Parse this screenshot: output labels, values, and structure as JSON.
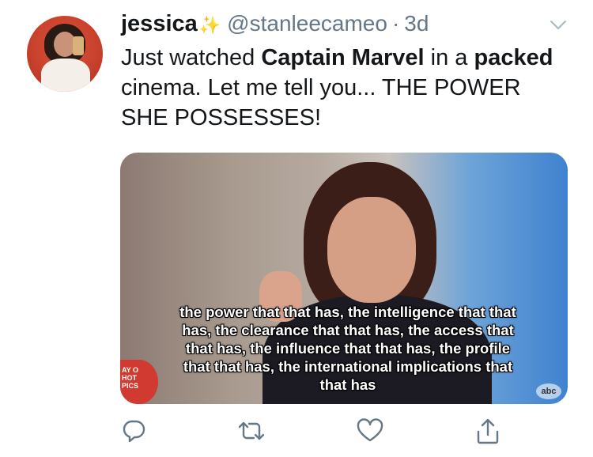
{
  "tweet": {
    "display_name": "jessica",
    "sparkle_icon": "sparkles-icon",
    "handle": "@stanleecameo",
    "separator": "·",
    "time": "3d",
    "text_parts": [
      {
        "text": "Just watched ",
        "bold": false
      },
      {
        "text": "Captain Marvel",
        "bold": true
      },
      {
        "text": " in a ",
        "bold": false
      },
      {
        "text": "packed",
        "bold": true
      },
      {
        "text": " cinema. Let me tell you... THE POWER SHE POSSESSES!",
        "bold": false
      }
    ]
  },
  "media": {
    "subtitle_lines": [
      "the power that that has, the intelligence that that",
      "has, the clearance that that has, the access that",
      "that has, the influence that that has, the profile",
      "that that has, the international implications that",
      "that has"
    ],
    "logo_left_text": "AY O\nHOT\nPICS",
    "logo_right_text": "abc"
  },
  "actions": {
    "reply_icon": "reply-icon",
    "retweet_icon": "retweet-icon",
    "like_icon": "heart-icon",
    "share_icon": "share-icon"
  },
  "colors": {
    "text_primary": "#14171a",
    "text_secondary": "#657786",
    "icon": "#657786",
    "sparkle": "#f0c93a"
  }
}
